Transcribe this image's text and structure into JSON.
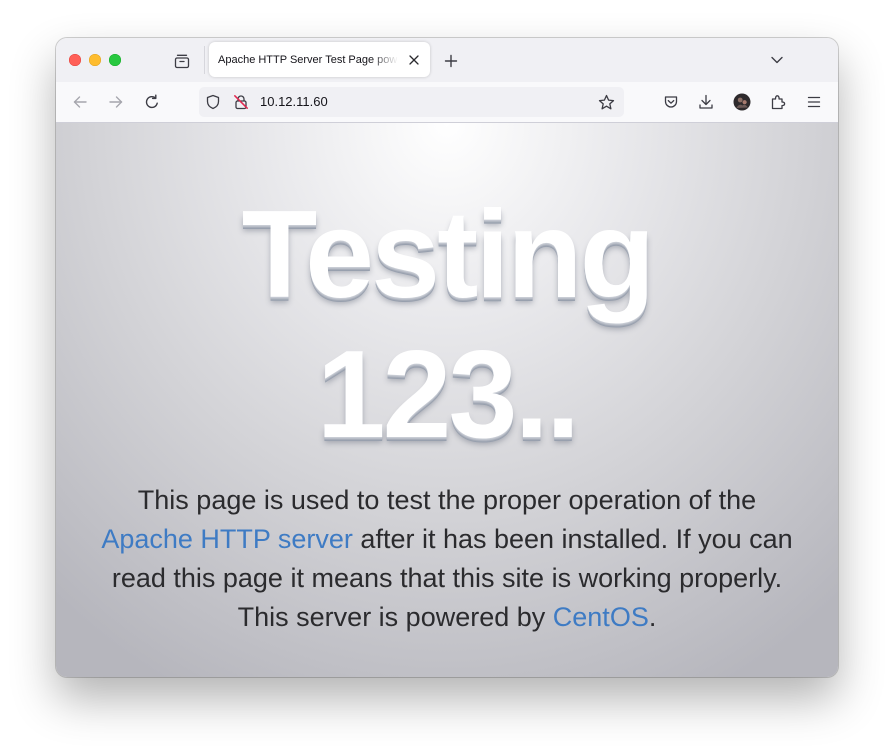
{
  "browser": {
    "tab": {
      "title": "Apache HTTP Server Test Page powered by CentOS"
    },
    "urlbar": {
      "url": "10.12.11.60"
    }
  },
  "icons": {
    "tab_overview": "tab-overview-icon",
    "tab_close": "close-icon",
    "new_tab": "plus-icon",
    "list_all_tabs": "chevron-down-icon",
    "back": "arrow-left-icon",
    "forward": "arrow-right-icon",
    "reload": "reload-icon",
    "tracking_protection": "shield-icon",
    "insecure_connection": "lock-crossed-icon",
    "bookmark": "star-icon",
    "pocket": "pocket-icon",
    "downloads": "download-icon",
    "account": "avatar-icon",
    "extensions": "puzzle-icon",
    "menu": "hamburger-icon"
  },
  "page": {
    "headline_line1": "Testing",
    "headline_line2": "123..",
    "desc_part1": "This page is used to test the proper operation of the ",
    "link_apache": "Apache HTTP server",
    "desc_part2": " after it has been installed. If you can read this page it means that this site is working properly. This server is powered by ",
    "link_centos": "CentOS",
    "desc_part3": "."
  },
  "colors": {
    "link": "#3e7bc4",
    "body_text": "#2b2b2e",
    "traffic_close": "#ff5f57",
    "traffic_minimize": "#febc2e",
    "traffic_maximize": "#28c840"
  }
}
